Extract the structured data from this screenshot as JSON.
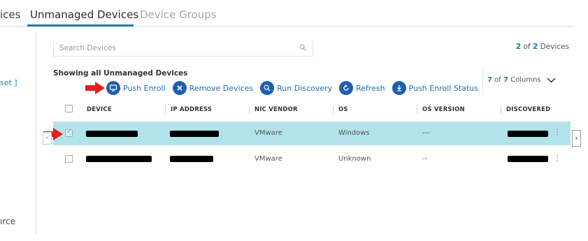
{
  "tabs": {
    "partial": "ices",
    "active": "Unmanaged Devices",
    "inactive": "Device Groups"
  },
  "left": {
    "reset": "set ]",
    "source": "ırce"
  },
  "search": {
    "placeholder": "Search Devices"
  },
  "count": {
    "shown": "2",
    "of": " of ",
    "total": "2",
    "suffix": " Devices"
  },
  "section": {
    "title": "Showing all Unmanaged Devices"
  },
  "toolbar": {
    "push_enroll": "Push Enroll",
    "remove_devices": "Remove Devices",
    "run_discovery": "Run Discovery",
    "refresh": "Refresh",
    "push_enroll_status": "Push Enroll Status"
  },
  "columns": {
    "shown": "7",
    "of": " of ",
    "total": "7",
    "suffix": " Columns"
  },
  "table": {
    "headers": [
      "DEVICE",
      "IP ADDRESS",
      "NIC VENDOR",
      "OS",
      "OS VERSION",
      "DISCOVERED"
    ],
    "rows": [
      {
        "device": "",
        "ip": "",
        "nic_vendor": "VMware",
        "os": "Windows",
        "os_version": "---",
        "discovered": "",
        "selected": true
      },
      {
        "device": "",
        "ip": "",
        "nic_vendor": "VMware",
        "os": "Unknown",
        "os_version": "--",
        "discovered": "",
        "selected": false
      }
    ]
  },
  "colors": {
    "accent": "#1f7aa8",
    "selected_row": "#b3e3ea",
    "icon_blue": "#1f5fb0",
    "annotation_red": "#e02020"
  }
}
